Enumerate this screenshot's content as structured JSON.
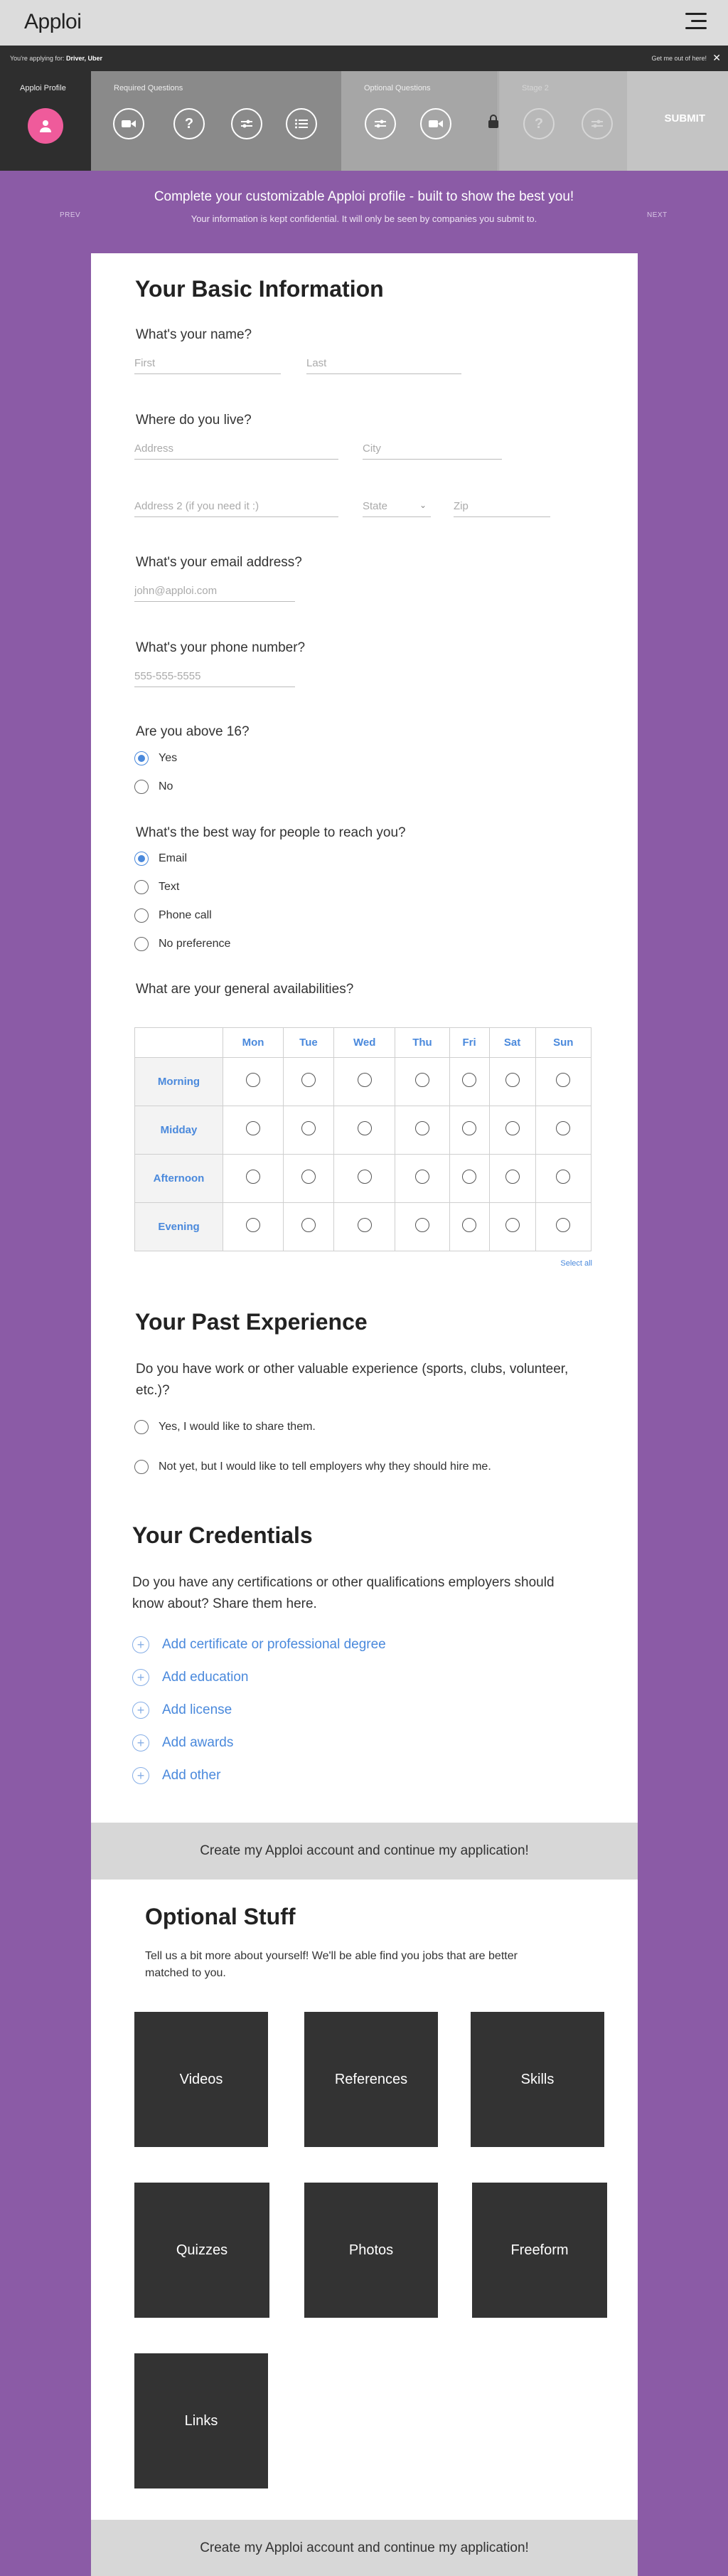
{
  "header": {
    "logo": "Apploi"
  },
  "apply_bar": {
    "prefix": "You're applying for:",
    "job": "Driver, Uber",
    "exit": "Get me out of here!"
  },
  "stepper": {
    "profile_label": "Apploi Profile",
    "required_label": "Required Questions",
    "optional_label": "Optional Questions",
    "stage2_label": "Stage 2",
    "submit_label": "SUBMIT"
  },
  "intro": {
    "prev": "PREV",
    "next": "NEXT",
    "title": "Complete your customizable Apploi profile - built to show the best you!",
    "subtitle": "Your information is kept confidential. It will only be seen by companies you submit to."
  },
  "basic": {
    "heading": "Your Basic Information",
    "name_q": "What's your name?",
    "first_ph": "First",
    "last_ph": "Last",
    "live_q": "Where do you live?",
    "address_ph": "Address",
    "city_ph": "City",
    "address2_ph": "Address 2 (if you need it :)",
    "state_label": "State",
    "zip_ph": "Zip",
    "email_q": "What's your email address?",
    "email_ph": "john@apploi.com",
    "phone_q": "What's your phone number?",
    "phone_ph": "555-555-5555",
    "age_q": "Are you above 16?",
    "age_options": [
      "Yes",
      "No"
    ],
    "age_selected": "Yes",
    "contact_q": "What's the best way for people to reach you?",
    "contact_options": [
      "Email",
      "Text",
      "Phone call",
      "No preference"
    ],
    "contact_selected": "Email",
    "avail_q": "What are your general availabilities?",
    "days": [
      "Mon",
      "Tue",
      "Wed",
      "Thu",
      "Fri",
      "Sat",
      "Sun"
    ],
    "times": [
      "Morning",
      "Midday",
      "Afternoon",
      "Evening"
    ],
    "select_all": "Select all"
  },
  "experience": {
    "heading": "Your Past Experience",
    "q": "Do you have work or other valuable experience (sports, clubs, volunteer, etc.)?",
    "options": [
      "Yes, I would like to share them.",
      "Not yet, but I would like to tell employers why they should hire me."
    ]
  },
  "credentials": {
    "heading": "Your Credentials",
    "q": "Do you have any certifications or other qualifications employers should know about? Share them here.",
    "add_items": [
      "Add certificate or professional degree",
      "Add education",
      "Add license",
      "Add awards",
      "Add other"
    ]
  },
  "cta": {
    "label": "Create my Apploi account and continue my application!"
  },
  "optional": {
    "heading": "Optional Stuff",
    "text": "Tell us a bit more about yourself! We'll be able find you jobs that are better matched to you.",
    "tiles": [
      "Videos",
      "References",
      "Skills",
      "Quizzes",
      "Photos",
      "Freeform",
      "Links"
    ]
  },
  "colors": {
    "purple": "#8b5ba6",
    "accent_blue": "#4a89dc",
    "pink": "#ef5b9b"
  }
}
